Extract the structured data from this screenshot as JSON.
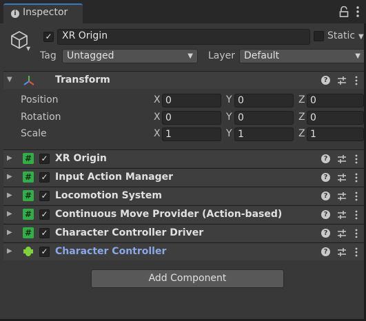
{
  "window": {
    "tab_label": "Inspector",
    "tab_icon": "info-icon"
  },
  "header": {
    "object_active": true,
    "object_name": "XR Origin",
    "static_label": "Static",
    "static_checked": false,
    "tag_label": "Tag",
    "tag_value": "Untagged",
    "layer_label": "Layer",
    "layer_value": "Default"
  },
  "transform": {
    "title": "Transform",
    "rows": [
      {
        "label": "Position",
        "x": "0",
        "y": "0",
        "z": "0"
      },
      {
        "label": "Rotation",
        "x": "0",
        "y": "0",
        "z": "0"
      },
      {
        "label": "Scale",
        "x": "1",
        "y": "1",
        "z": "1"
      }
    ],
    "axis_labels": {
      "x": "X",
      "y": "Y",
      "z": "Z"
    }
  },
  "components": [
    {
      "title": "XR Origin",
      "enabled": true,
      "icon": "script-icon"
    },
    {
      "title": "Input Action Manager",
      "enabled": true,
      "icon": "script-icon"
    },
    {
      "title": "Locomotion System",
      "enabled": true,
      "icon": "script-icon"
    },
    {
      "title": "Continuous Move Provider (Action-based)",
      "enabled": true,
      "icon": "script-icon"
    },
    {
      "title": "Character Controller Driver",
      "enabled": true,
      "icon": "script-icon"
    },
    {
      "title": "Character Controller",
      "enabled": true,
      "icon": "character-controller-icon",
      "highlight": true
    }
  ],
  "add_component_label": "Add Component",
  "colors": {
    "background": "#383838",
    "accent_blue": "#3a79bb",
    "highlight_text": "#89a8e6",
    "script_green": "#2fb047"
  }
}
